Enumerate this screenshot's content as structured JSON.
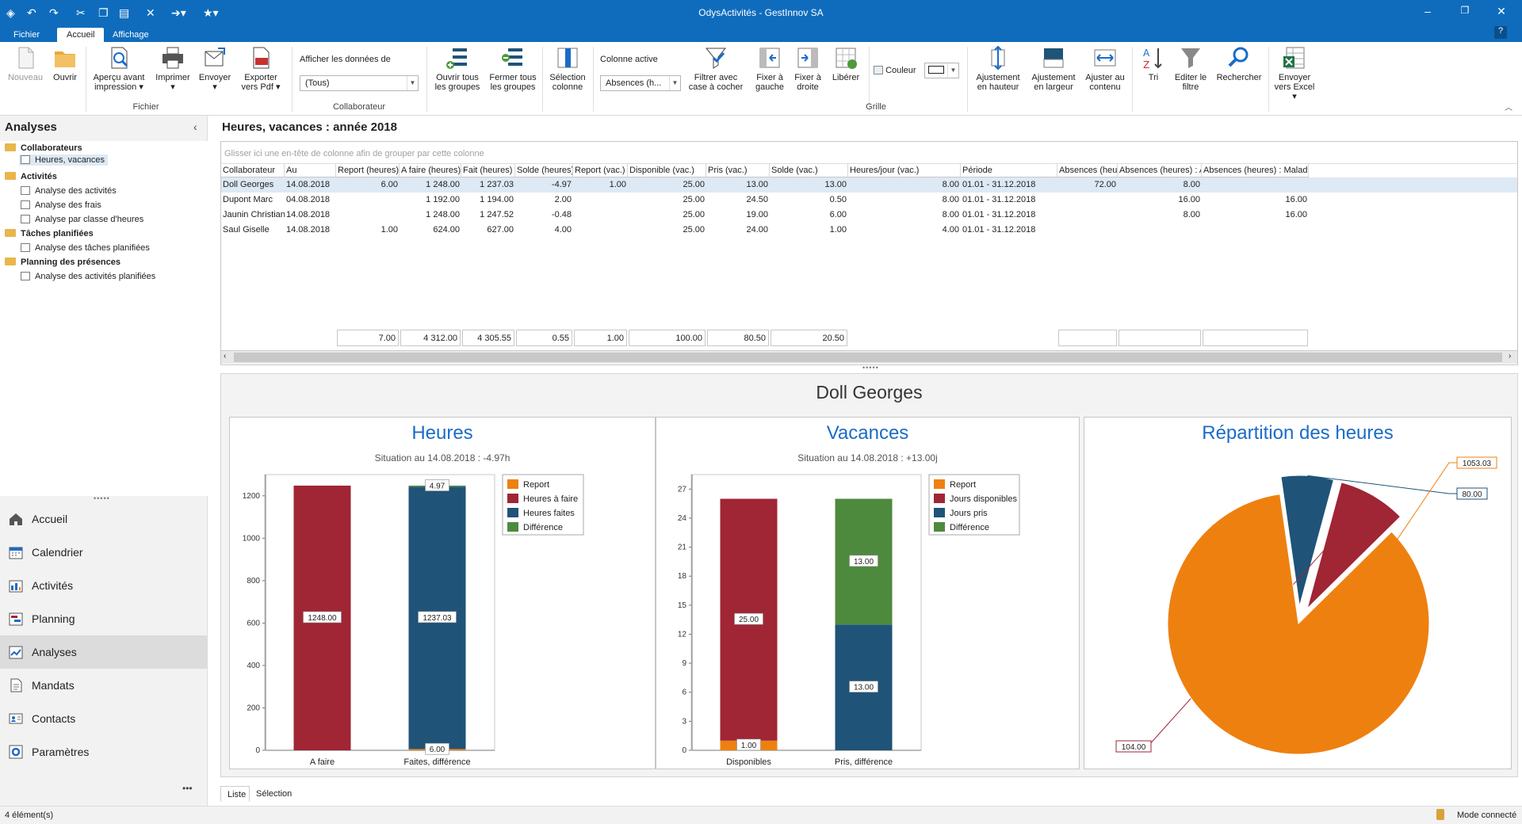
{
  "window": {
    "title": "OdysActivités - GestInnov SA"
  },
  "ribbon_tabs": [
    {
      "label": "Fichier"
    },
    {
      "label": "Accueil"
    },
    {
      "label": "Affichage"
    }
  ],
  "ribbon": {
    "nouveau": "Nouveau",
    "ouvrir": "Ouvrir",
    "apercu": "Aperçu avant impression",
    "imprimer": "Imprimer",
    "envoyer": "Envoyer",
    "exporter_pdf": "Exporter vers Pdf",
    "groupe_fichier": "Fichier",
    "afficher_donnees_label": "Afficher les données de",
    "afficher_donnees_value": "(Tous)",
    "groupe_collaborateur": "Collaborateur",
    "ouvrir_groupes": "Ouvrir tous les groupes",
    "fermer_groupes": "Fermer tous les groupes",
    "selection_colonne": "Sélection colonne",
    "colonne_active_label": "Colonne active",
    "colonne_active_value": "Absences (h...",
    "filtrer": "Filtrer avec case à cocher",
    "fixer_gauche": "Fixer à gauche",
    "fixer_droite": "Fixer à droite",
    "liberer": "Libérer",
    "couleur": "Couleur",
    "groupe_grille": "Grille",
    "ajust_hauteur": "Ajustement en hauteur",
    "ajust_largeur": "Ajustement en largeur",
    "ajuster_contenu": "Ajuster au contenu",
    "tri": "Tri",
    "editer_filtre": "Editer le filtre",
    "rechercher": "Rechercher",
    "envoyer_excel": "Envoyer vers Excel"
  },
  "sidebar": {
    "title": "Analyses",
    "tree": [
      {
        "label": "Collaborateurs",
        "type": "group"
      },
      {
        "label": "Heures, vacances",
        "type": "item",
        "selected": true
      },
      {
        "label": "Activités",
        "type": "group"
      },
      {
        "label": "Analyse des activités",
        "type": "item"
      },
      {
        "label": "Analyse des frais",
        "type": "item"
      },
      {
        "label": "Analyse par classe d'heures",
        "type": "item"
      },
      {
        "label": "Tâches planifiées",
        "type": "group"
      },
      {
        "label": "Analyse des tâches planifiées",
        "type": "item"
      },
      {
        "label": "Planning des présences",
        "type": "group"
      },
      {
        "label": "Analyse des activités planifiées",
        "type": "item"
      }
    ],
    "nav": [
      {
        "label": "Accueil"
      },
      {
        "label": "Calendrier"
      },
      {
        "label": "Activités"
      },
      {
        "label": "Planning"
      },
      {
        "label": "Analyses"
      },
      {
        "label": "Mandats"
      },
      {
        "label": "Contacts"
      },
      {
        "label": "Paramètres"
      }
    ],
    "more": "•••"
  },
  "main": {
    "title": "Heures, vacances : année 2018",
    "group_hint": "Glisser ici une en-tête de colonne afin de grouper par cette colonne",
    "columns": [
      "Collaborateur",
      "Au",
      "Report (heures)",
      "A faire (heures)",
      "Fait (heures)",
      "Solde (heures)",
      "Report (vac.)",
      "Disponible (vac.)",
      "Pris (vac.)",
      "Solde (vac.)",
      "Heures/jour (vac.)",
      "Période",
      "Absences (heur...",
      "Absences (heures) : A...",
      "Absences (heures) : Maladie"
    ],
    "rows": [
      [
        "Doll Georges",
        "14.08.2018",
        "6.00",
        "1 248.00",
        "1 237.03",
        "-4.97",
        "1.00",
        "25.00",
        "13.00",
        "13.00",
        "8.00",
        "01.01 - 31.12.2018",
        "72.00",
        "8.00",
        ""
      ],
      [
        "Dupont Marc",
        "04.08.2018",
        "",
        "1 192.00",
        "1 194.00",
        "2.00",
        "",
        "25.00",
        "24.50",
        "0.50",
        "8.00",
        "01.01 - 31.12.2018",
        "",
        "16.00",
        "16.00"
      ],
      [
        "Jaunin Christian",
        "14.08.2018",
        "",
        "1 248.00",
        "1 247.52",
        "-0.48",
        "",
        "25.00",
        "19.00",
        "6.00",
        "8.00",
        "01.01 - 31.12.2018",
        "",
        "8.00",
        "16.00"
      ],
      [
        "Saul Giselle",
        "14.08.2018",
        "1.00",
        "624.00",
        "627.00",
        "4.00",
        "",
        "25.00",
        "24.00",
        "1.00",
        "4.00",
        "01.01 - 31.12.2018",
        "",
        "",
        ""
      ]
    ],
    "totals": [
      "7.00",
      "4 312.00",
      "4 305.55",
      "0.55",
      "1.00",
      "100.00",
      "80.50",
      "20.50"
    ],
    "person": "Doll Georges",
    "bottom_tabs": [
      "Liste",
      "Sélection"
    ]
  },
  "chart_data": [
    {
      "type": "bar",
      "stacked": true,
      "title": "Heures",
      "subtitle": "Situation au 14.08.2018 : -4.97h",
      "categories": [
        "A faire",
        "Faites, différence"
      ],
      "yticks": [
        "0",
        "200",
        "400",
        "600",
        "800",
        "1000",
        "1200"
      ],
      "ylim": [
        0,
        1300
      ],
      "series": [
        {
          "name": "Report",
          "color": "#ee8010",
          "values": [
            0,
            6.0
          ]
        },
        {
          "name": "Heures à faire",
          "color": "#a02535",
          "values": [
            1248.0,
            0
          ]
        },
        {
          "name": "Heures faites",
          "color": "#1f5378",
          "values": [
            0,
            1237.03
          ]
        },
        {
          "name": "Différence",
          "color": "#4e8a3e",
          "values": [
            0,
            4.97
          ]
        }
      ],
      "labels": [
        "1248.00",
        "1237.03",
        "6.00",
        "4.97"
      ]
    },
    {
      "type": "bar",
      "stacked": true,
      "title": "Vacances",
      "subtitle": "Situation au 14.08.2018 : +13.00j",
      "categories": [
        "Disponibles",
        "Pris, différence"
      ],
      "yticks": [
        "0",
        "3",
        "6",
        "9",
        "12",
        "15",
        "18",
        "21",
        "24",
        "27"
      ],
      "ylim": [
        0,
        28.5
      ],
      "series": [
        {
          "name": "Report",
          "color": "#ee8010",
          "values": [
            1.0,
            0
          ]
        },
        {
          "name": "Jours disponibles",
          "color": "#a02535",
          "values": [
            25.0,
            0
          ]
        },
        {
          "name": "Jours pris",
          "color": "#1f5378",
          "values": [
            0,
            13.0
          ]
        },
        {
          "name": "Différence",
          "color": "#4e8a3e",
          "values": [
            0,
            13.0
          ]
        }
      ],
      "labels": [
        "1.00",
        "25.00",
        "13.00",
        "13.00"
      ]
    },
    {
      "type": "pie",
      "title": "Répartition des heures",
      "slices": [
        {
          "value": 1053.03,
          "label": "1053.03",
          "color": "#ee8010"
        },
        {
          "value": 80.0,
          "label": "80.00",
          "color": "#1f5378"
        },
        {
          "value": 104.0,
          "label": "104.00",
          "color": "#a02535"
        }
      ]
    }
  ],
  "status": {
    "count": "4 élément(s)",
    "mode": "Mode connecté"
  }
}
